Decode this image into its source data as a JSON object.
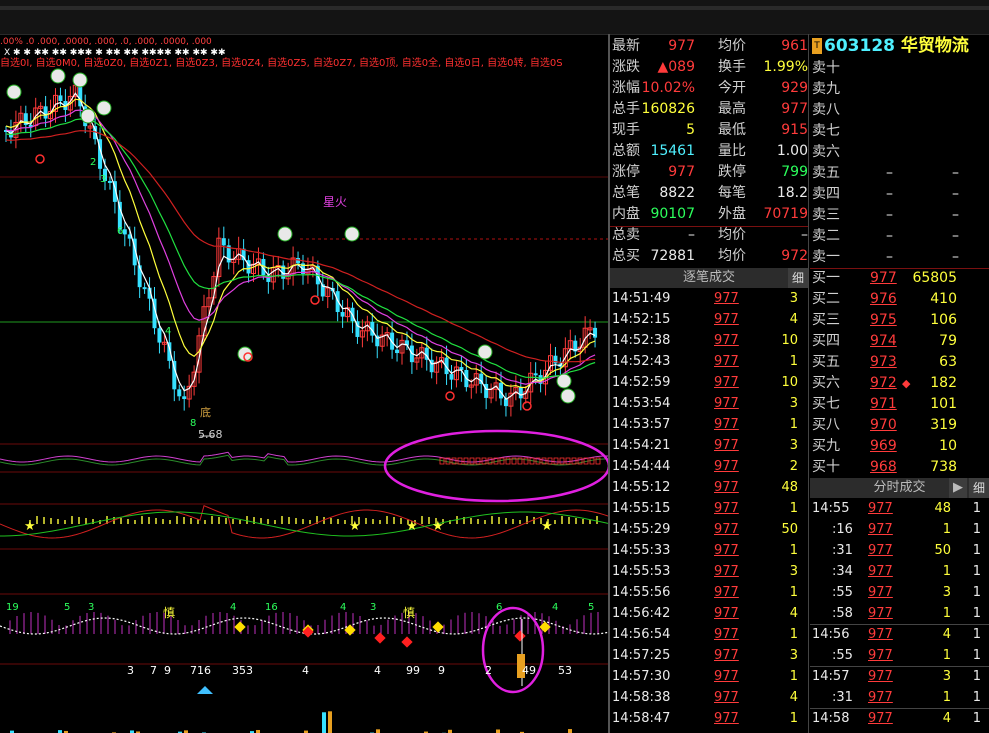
{
  "stock": {
    "code": "603128",
    "name": "华贸物流",
    "badge": "T"
  },
  "chart_top": {
    "strip": ".00% .0 .000, .0000, .000, .0, .000, .0000, .000",
    "marks": "X  ✱  ✱  ✱✱  ✱✱  ✱✱✱  ✱  ✱✱  ✱✱  ✱✱✱✱  ✱✱  ✱✱  ✱✱",
    "picks": "自选0I, 自选0M0, 自选0Z0, 自选0Z1, 自选0Z3, 自选0Z4, 自选0Z5, 自选0Z7, 自选0顶, 自选0全, 自选0日, 自选0转, 自选0S"
  },
  "chart_labels": {
    "price_low": "5.68",
    "xinghuo": "星火",
    "shen": "慎",
    "shen2": "慎",
    "di": "底",
    "n2": "2",
    "n3": "3",
    "n6": "6",
    "n4": "4",
    "n8": "8",
    "sub3_nums": [
      "19",
      "5",
      "3",
      "4",
      "16",
      "4",
      "3",
      "6",
      "4",
      "5"
    ],
    "sub3_bottom": [
      "3",
      "7",
      "9",
      "716",
      "353",
      "4",
      "4",
      "99",
      "9",
      "2",
      "49",
      "53"
    ]
  },
  "quote": {
    "rows": [
      {
        "l1": "最新",
        "v1": "977",
        "c1": "red",
        "l2": "均价",
        "v2": "961",
        "c2": "red"
      },
      {
        "l1": "涨跌",
        "v1": "▲089",
        "c1": "red",
        "l2": "换手",
        "v2": "1.99%",
        "c2": "yellow"
      },
      {
        "l1": "涨幅",
        "v1": "10.02%",
        "c1": "red",
        "l2": "今开",
        "v2": "929",
        "c2": "red"
      },
      {
        "l1": "总手",
        "v1": "160826",
        "c1": "yellow",
        "l2": "最高",
        "v2": "977",
        "c2": "red"
      },
      {
        "l1": "现手",
        "v1": "5",
        "c1": "yellow",
        "l2": "最低",
        "v2": "915",
        "c2": "red"
      },
      {
        "l1": "总额",
        "v1": "15461",
        "c1": "cyan",
        "l2": "量比",
        "v2": "1.00",
        "c2": "white"
      },
      {
        "l1": "涨停",
        "v1": "977",
        "c1": "red",
        "l2": "跌停",
        "v2": "799",
        "c2": "green"
      },
      {
        "l1": "总笔",
        "v1": "8822",
        "c1": "white",
        "l2": "每笔",
        "v2": "18.2",
        "c2": "white"
      },
      {
        "l1": "内盘",
        "v1": "90107",
        "c1": "green",
        "l2": "外盘",
        "v2": "70719",
        "c2": "red"
      },
      {
        "l1": "总卖",
        "v1": "–",
        "c1": "white",
        "l2": "均价",
        "v2": "–",
        "c2": "white"
      },
      {
        "l1": "总买",
        "v1": "72881",
        "c1": "white",
        "l2": "均价",
        "v2": "972",
        "c2": "red"
      }
    ]
  },
  "ticks_header": {
    "title": "逐笔成交",
    "tab": "细"
  },
  "ticks": [
    {
      "t": "14:51:49",
      "p": "977",
      "v": "3"
    },
    {
      "t": "14:52:15",
      "p": "977",
      "v": "4"
    },
    {
      "t": "14:52:38",
      "p": "977",
      "v": "10"
    },
    {
      "t": "14:52:43",
      "p": "977",
      "v": "1"
    },
    {
      "t": "14:52:59",
      "p": "977",
      "v": "10"
    },
    {
      "t": "14:53:54",
      "p": "977",
      "v": "3"
    },
    {
      "t": "14:53:57",
      "p": "977",
      "v": "1"
    },
    {
      "t": "14:54:21",
      "p": "977",
      "v": "3"
    },
    {
      "t": "14:54:44",
      "p": "977",
      "v": "2"
    },
    {
      "t": "14:55:12",
      "p": "977",
      "v": "48"
    },
    {
      "t": "14:55:15",
      "p": "977",
      "v": "1"
    },
    {
      "t": "14:55:29",
      "p": "977",
      "v": "50"
    },
    {
      "t": "14:55:33",
      "p": "977",
      "v": "1"
    },
    {
      "t": "14:55:53",
      "p": "977",
      "v": "3"
    },
    {
      "t": "14:55:56",
      "p": "977",
      "v": "1"
    },
    {
      "t": "14:56:42",
      "p": "977",
      "v": "4"
    },
    {
      "t": "14:56:54",
      "p": "977",
      "v": "1"
    },
    {
      "t": "14:57:25",
      "p": "977",
      "v": "3"
    },
    {
      "t": "14:57:30",
      "p": "977",
      "v": "1"
    },
    {
      "t": "14:58:38",
      "p": "977",
      "v": "4"
    },
    {
      "t": "14:58:47",
      "p": "977",
      "v": "1"
    }
  ],
  "sell_book": [
    {
      "label": "卖十",
      "p": "",
      "v": ""
    },
    {
      "label": "卖九",
      "p": "",
      "v": ""
    },
    {
      "label": "卖八",
      "p": "",
      "v": ""
    },
    {
      "label": "卖七",
      "p": "",
      "v": ""
    },
    {
      "label": "卖六",
      "p": "",
      "v": ""
    },
    {
      "label": "卖五",
      "p": "–",
      "v": "–"
    },
    {
      "label": "卖四",
      "p": "–",
      "v": "–"
    },
    {
      "label": "卖三",
      "p": "–",
      "v": "–"
    },
    {
      "label": "卖二",
      "p": "–",
      "v": "–"
    },
    {
      "label": "卖一",
      "p": "–",
      "v": "–"
    }
  ],
  "buy_book": [
    {
      "label": "买一",
      "p": "977",
      "v": "65805",
      "mark": ""
    },
    {
      "label": "买二",
      "p": "976",
      "v": "410",
      "mark": ""
    },
    {
      "label": "买三",
      "p": "975",
      "v": "106",
      "mark": ""
    },
    {
      "label": "买四",
      "p": "974",
      "v": "79",
      "mark": ""
    },
    {
      "label": "买五",
      "p": "973",
      "v": "63",
      "mark": ""
    },
    {
      "label": "买六",
      "p": "972",
      "v": "182",
      "mark": "◆"
    },
    {
      "label": "买七",
      "p": "971",
      "v": "101",
      "mark": ""
    },
    {
      "label": "买八",
      "p": "970",
      "v": "319",
      "mark": ""
    },
    {
      "label": "买九",
      "p": "969",
      "v": "10",
      "mark": ""
    },
    {
      "label": "买十",
      "p": "968",
      "v": "738",
      "mark": ""
    }
  ],
  "fenshi_header": {
    "title": "分时成交",
    "arrow": "▶",
    "tab": "细"
  },
  "fenshi": [
    {
      "t": "14:55",
      "p": "977",
      "v": "48",
      "n": "1"
    },
    {
      "t": ":16",
      "p": "977",
      "v": "1",
      "n": "1"
    },
    {
      "t": ":31",
      "p": "977",
      "v": "50",
      "n": "1"
    },
    {
      "t": ":34",
      "p": "977",
      "v": "1",
      "n": "1"
    },
    {
      "t": ":55",
      "p": "977",
      "v": "3",
      "n": "1"
    },
    {
      "t": ":58",
      "p": "977",
      "v": "1",
      "n": "1"
    },
    {
      "t": "14:56",
      "p": "977",
      "v": "4",
      "n": "1"
    },
    {
      "t": ":55",
      "p": "977",
      "v": "1",
      "n": "1"
    },
    {
      "t": "14:57",
      "p": "977",
      "v": "3",
      "n": "1"
    },
    {
      "t": ":31",
      "p": "977",
      "v": "1",
      "n": "1"
    },
    {
      "t": "14:58",
      "p": "977",
      "v": "4",
      "n": "1"
    }
  ],
  "colors": {
    "up": "#ff3b3b",
    "down": "#36e0ff",
    "ma5": "#ffffff",
    "ma10": "#ffff3c",
    "ma20": "#e040e0",
    "ma60": "#20e040",
    "ma120": "#d02020",
    "circle": "#e020e0"
  }
}
